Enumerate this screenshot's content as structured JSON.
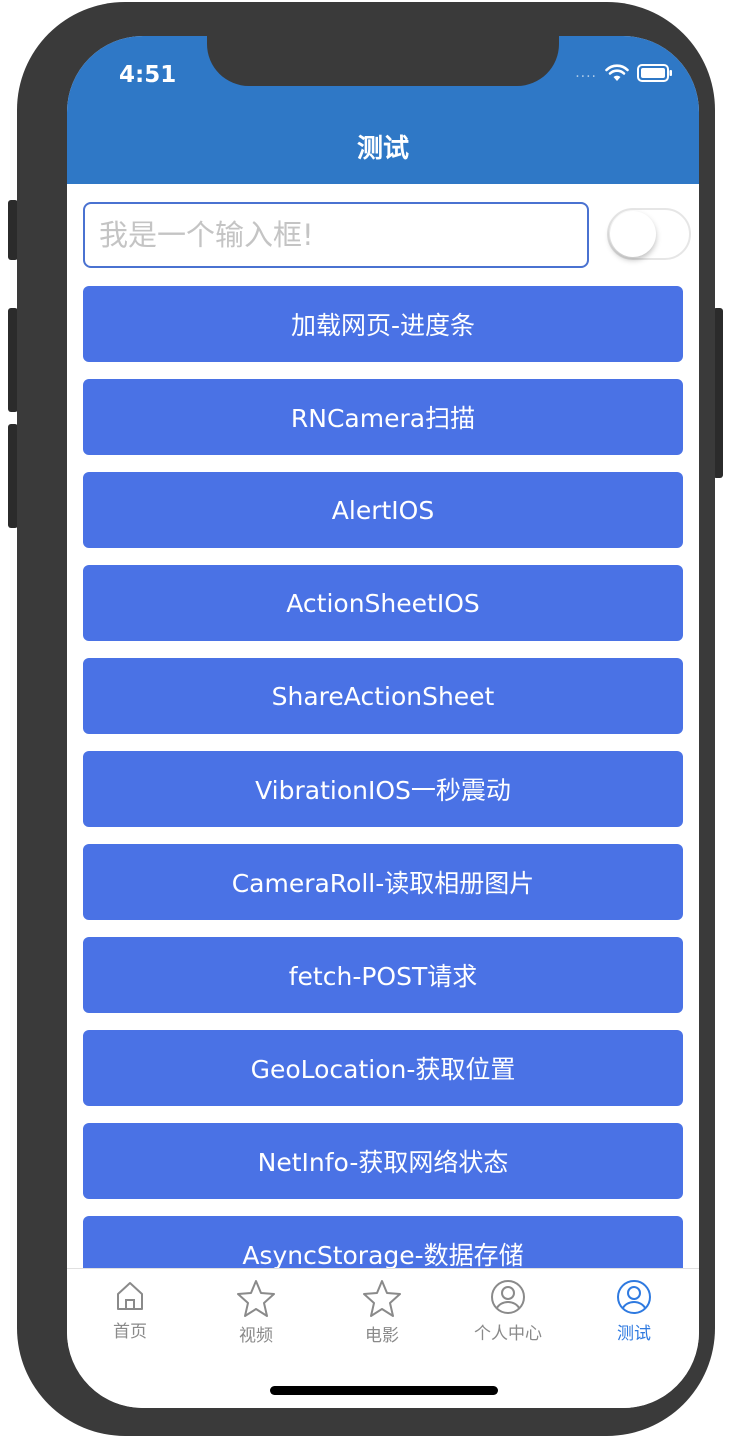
{
  "status_bar": {
    "time": "4:51",
    "signal_dots": "...."
  },
  "nav": {
    "title": "测试"
  },
  "input": {
    "placeholder": "我是一个输入框!",
    "value": ""
  },
  "toggle": {
    "on": false
  },
  "buttons": [
    "加载网页-进度条",
    "RNCamera扫描",
    "AlertIOS",
    "ActionSheetIOS",
    "ShareActionSheet",
    "VibrationIOS一秒震动",
    "CameraRoll-读取相册图片",
    "fetch-POST请求",
    "GeoLocation-获取位置",
    "NetInfo-获取网络状态",
    "AsyncStorage-数据存储"
  ],
  "tabs": [
    {
      "label": "首页",
      "icon": "home-icon",
      "active": false
    },
    {
      "label": "视频",
      "icon": "star-icon",
      "active": false
    },
    {
      "label": "电影",
      "icon": "star-icon",
      "active": false
    },
    {
      "label": "个人中心",
      "icon": "person-icon",
      "active": false
    },
    {
      "label": "测试",
      "icon": "person-icon",
      "active": true
    }
  ],
  "colors": {
    "nav_bar": "#2f78c6",
    "button": "#4a72e5",
    "tab_active": "#2f7ae0",
    "tab_inactive": "#8a8a8a"
  }
}
